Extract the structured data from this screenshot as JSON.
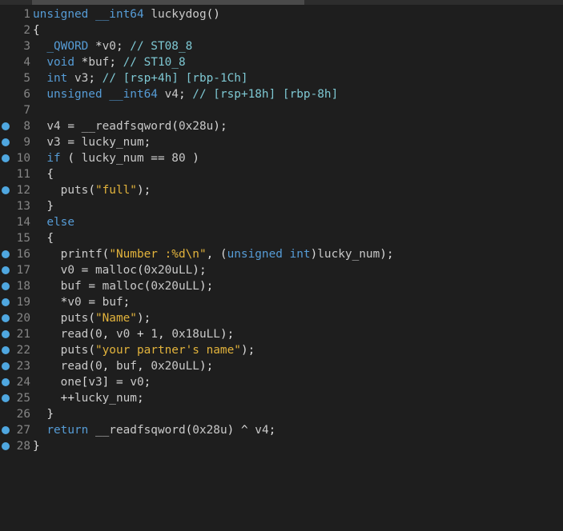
{
  "lines": [
    {
      "no": "1",
      "bp": false,
      "text": "unsigned __int64 luckydog()"
    },
    {
      "no": "2",
      "bp": false,
      "text": "{"
    },
    {
      "no": "3",
      "bp": false,
      "text": "  _QWORD *v0; // ST08_8"
    },
    {
      "no": "4",
      "bp": false,
      "text": "  void *buf; // ST10_8"
    },
    {
      "no": "5",
      "bp": false,
      "text": "  int v3; // [rsp+4h] [rbp-1Ch]"
    },
    {
      "no": "6",
      "bp": false,
      "text": "  unsigned __int64 v4; // [rsp+18h] [rbp-8h]"
    },
    {
      "no": "7",
      "bp": false,
      "text": ""
    },
    {
      "no": "8",
      "bp": true,
      "text": "  v4 = __readfsqword(0x28u);"
    },
    {
      "no": "9",
      "bp": true,
      "text": "  v3 = lucky_num;"
    },
    {
      "no": "10",
      "bp": true,
      "text": "  if ( lucky_num == 80 )"
    },
    {
      "no": "11",
      "bp": false,
      "text": "  {"
    },
    {
      "no": "12",
      "bp": true,
      "text": "    puts(\"full\");"
    },
    {
      "no": "13",
      "bp": false,
      "text": "  }"
    },
    {
      "no": "14",
      "bp": false,
      "text": "  else"
    },
    {
      "no": "15",
      "bp": false,
      "text": "  {"
    },
    {
      "no": "16",
      "bp": true,
      "text": "    printf(\"Number :%d\\n\", (unsigned int)lucky_num);"
    },
    {
      "no": "17",
      "bp": true,
      "text": "    v0 = malloc(0x20uLL);"
    },
    {
      "no": "18",
      "bp": true,
      "text": "    buf = malloc(0x20uLL);"
    },
    {
      "no": "19",
      "bp": true,
      "text": "    *v0 = buf;"
    },
    {
      "no": "20",
      "bp": true,
      "text": "    puts(\"Name\");"
    },
    {
      "no": "21",
      "bp": true,
      "text": "    read(0, v0 + 1, 0x18uLL);"
    },
    {
      "no": "22",
      "bp": true,
      "text": "    puts(\"your partner's name\");"
    },
    {
      "no": "23",
      "bp": true,
      "text": "    read(0, buf, 0x20uLL);"
    },
    {
      "no": "24",
      "bp": true,
      "text": "    one[v3] = v0;"
    },
    {
      "no": "25",
      "bp": true,
      "text": "    ++lucky_num;"
    },
    {
      "no": "26",
      "bp": false,
      "text": "  }"
    },
    {
      "no": "27",
      "bp": true,
      "text": "  return __readfsqword(0x28u) ^ v4;"
    },
    {
      "no": "28",
      "bp": true,
      "text": "}"
    }
  ],
  "colors": {
    "background": "#1e1e1e",
    "breakpoint": "#4fa7e0",
    "keyword": "#569cd6",
    "string": "#e2b33c",
    "comment": "#7ec8d3",
    "line_number": "#858585"
  }
}
